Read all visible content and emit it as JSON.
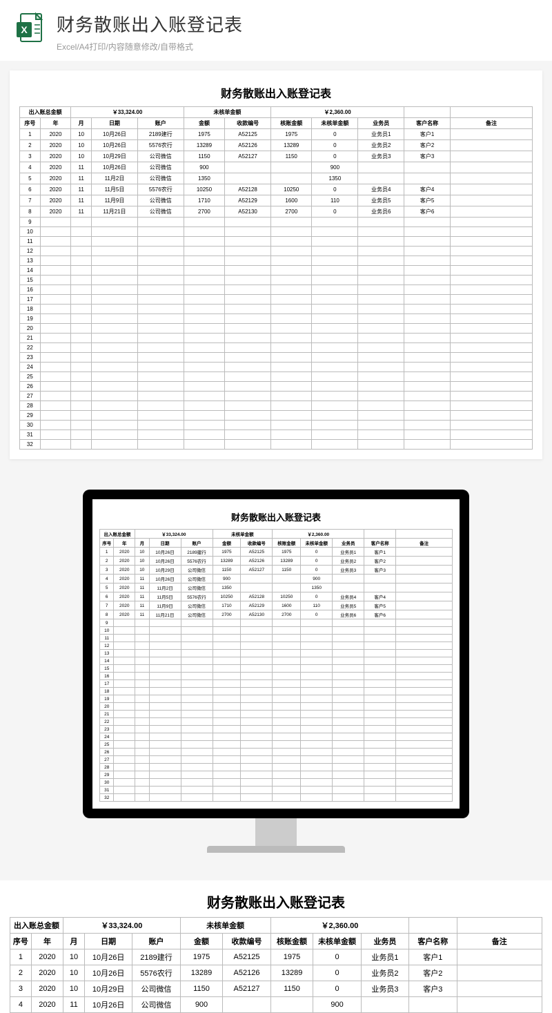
{
  "header": {
    "title": "财务散账出入账登记表",
    "subtitle": "Excel/A4打印/内容随意修改/自带格式",
    "icon_name": "excel-file-icon"
  },
  "sheet": {
    "title": "财务散账出入账登记表",
    "summary": {
      "total_label": "出入账总金额",
      "total_value": "￥33,324.00",
      "unverified_label": "未核单金额",
      "unverified_value": "￥2,360.00"
    },
    "columns": [
      "序号",
      "年",
      "月",
      "日期",
      "账户",
      "金额",
      "收款编号",
      "核账金额",
      "未核单金额",
      "业务员",
      "客户名称",
      "备注"
    ],
    "rows": [
      {
        "seq": "1",
        "year": "2020",
        "month": "10",
        "date": "10月26日",
        "acct": "2189建行",
        "amt": "1975",
        "code": "A52125",
        "vamt": "1975",
        "uamt": "0",
        "sales": "业务员1",
        "cust": "客户1",
        "note": ""
      },
      {
        "seq": "2",
        "year": "2020",
        "month": "10",
        "date": "10月26日",
        "acct": "5576农行",
        "amt": "13289",
        "code": "A52126",
        "vamt": "13289",
        "uamt": "0",
        "sales": "业务员2",
        "cust": "客户2",
        "note": ""
      },
      {
        "seq": "3",
        "year": "2020",
        "month": "10",
        "date": "10月29日",
        "acct": "公司微信",
        "amt": "1150",
        "code": "A52127",
        "vamt": "1150",
        "uamt": "0",
        "sales": "业务员3",
        "cust": "客户3",
        "note": ""
      },
      {
        "seq": "4",
        "year": "2020",
        "month": "11",
        "date": "10月26日",
        "acct": "公司微信",
        "amt": "900",
        "code": "",
        "vamt": "",
        "uamt": "900",
        "sales": "",
        "cust": "",
        "note": ""
      },
      {
        "seq": "5",
        "year": "2020",
        "month": "11",
        "date": "11月2日",
        "acct": "公司微信",
        "amt": "1350",
        "code": "",
        "vamt": "",
        "uamt": "1350",
        "sales": "",
        "cust": "",
        "note": ""
      },
      {
        "seq": "6",
        "year": "2020",
        "month": "11",
        "date": "11月5日",
        "acct": "5576农行",
        "amt": "10250",
        "code": "A52128",
        "vamt": "10250",
        "uamt": "0",
        "sales": "业务员4",
        "cust": "客户4",
        "note": ""
      },
      {
        "seq": "7",
        "year": "2020",
        "month": "11",
        "date": "11月9日",
        "acct": "公司微信",
        "amt": "1710",
        "code": "A52129",
        "vamt": "1600",
        "uamt": "110",
        "sales": "业务员5",
        "cust": "客户5",
        "note": ""
      },
      {
        "seq": "8",
        "year": "2020",
        "month": "11",
        "date": "11月21日",
        "acct": "公司微信",
        "amt": "2700",
        "code": "A52130",
        "vamt": "2700",
        "uamt": "0",
        "sales": "业务员6",
        "cust": "客户6",
        "note": ""
      }
    ],
    "empty_rows_from": 9,
    "empty_rows_to": 32
  },
  "bottom_strip_visible_rows": 4
}
